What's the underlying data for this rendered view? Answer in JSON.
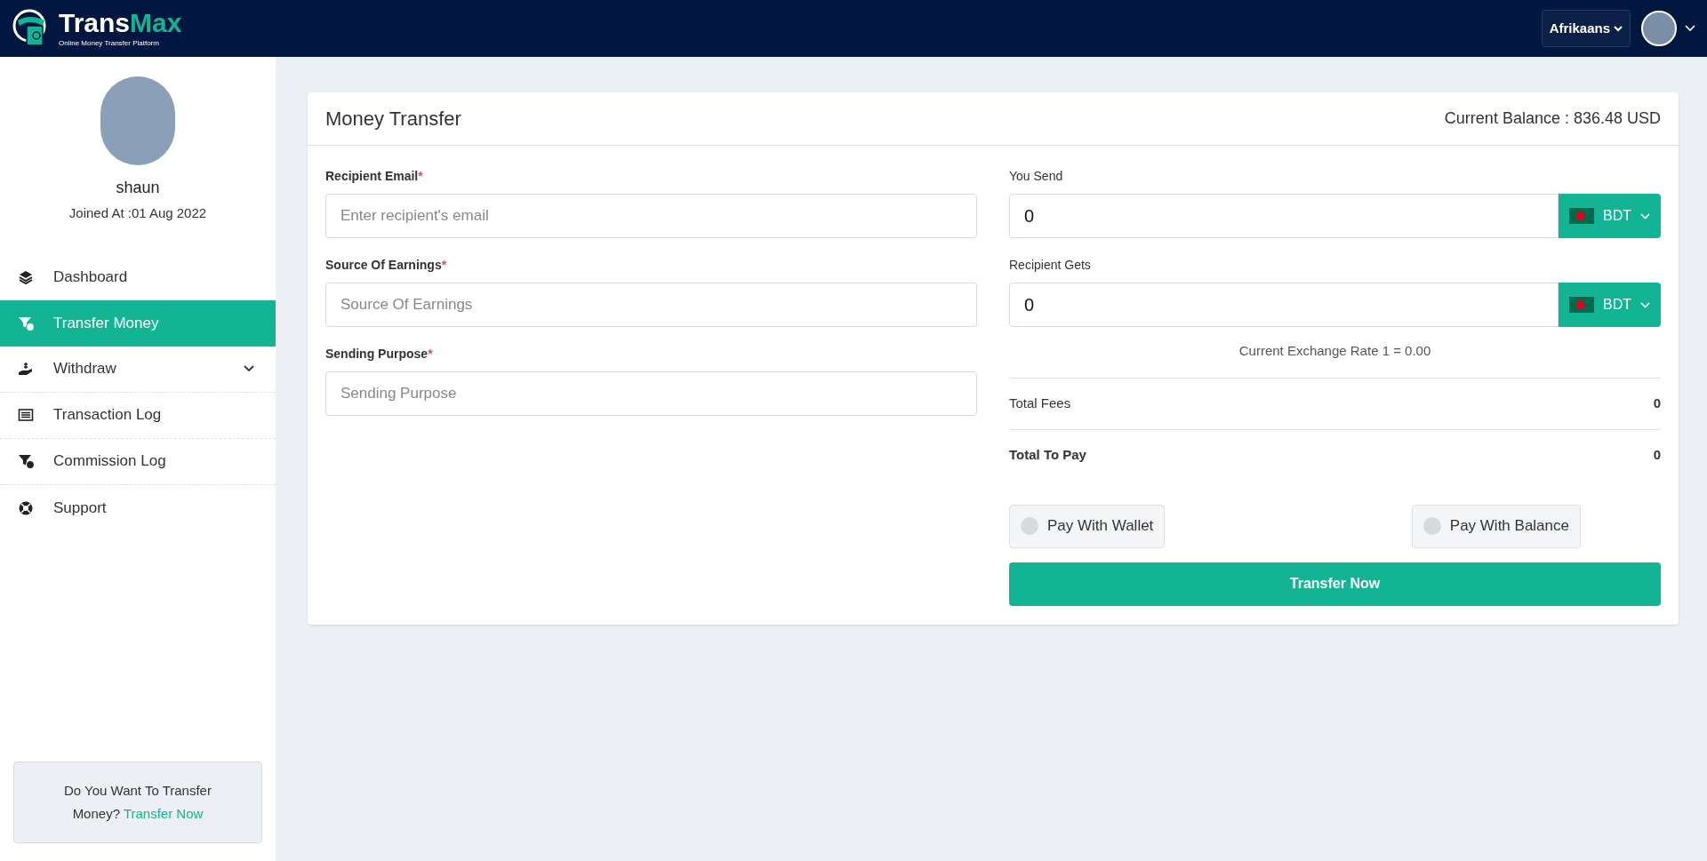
{
  "header": {
    "logo": {
      "name_part1": "Trans",
      "name_part2": "Max",
      "tagline": "Online Money Transfer Platform"
    },
    "language": "Afrikaans"
  },
  "sidebar": {
    "profile": {
      "name": "shaun",
      "joined": "Joined At :01 Aug 2022"
    },
    "items": [
      {
        "label": "Dashboard",
        "selected": false,
        "has_submenu": false
      },
      {
        "label": "Transfer Money",
        "selected": true,
        "has_submenu": false
      },
      {
        "label": "Withdraw",
        "selected": false,
        "has_submenu": true
      },
      {
        "label": "Transaction Log",
        "selected": false,
        "has_submenu": false
      },
      {
        "label": "Commission Log",
        "selected": false,
        "has_submenu": false
      },
      {
        "label": "Support",
        "selected": false,
        "has_submenu": false
      }
    ],
    "promo": {
      "text": "Do You Want To Transfer Money?",
      "link": "Transfer Now"
    }
  },
  "card": {
    "title": "Money Transfer",
    "balance": "Current Balance : 836.48 USD",
    "left_fields": [
      {
        "label": "Recipient Email",
        "required_mark": "*",
        "placeholder": "Enter recipient's email"
      },
      {
        "label": "Source Of Earnings",
        "required_mark": "*",
        "placeholder": "Source Of Earnings"
      },
      {
        "label": "Sending Purpose",
        "required_mark": "*",
        "placeholder": "Sending Purpose"
      }
    ],
    "amount_fields": [
      {
        "label": "You Send",
        "value": "0",
        "currency": "BDT"
      },
      {
        "label": "Recipient Gets",
        "value": "0",
        "currency": "BDT"
      }
    ],
    "exchange_rate": "Current Exchange Rate 1 = 0.00",
    "totals": [
      {
        "label": "Total Fees",
        "value": "0",
        "emphasis": false
      },
      {
        "label": "Total To Pay",
        "value": "0",
        "emphasis": true
      }
    ],
    "payment_options": [
      {
        "label": "Pay With Wallet",
        "selected": false
      },
      {
        "label": "Pay With Balance",
        "selected": false
      }
    ],
    "submit": "Transfer Now"
  }
}
